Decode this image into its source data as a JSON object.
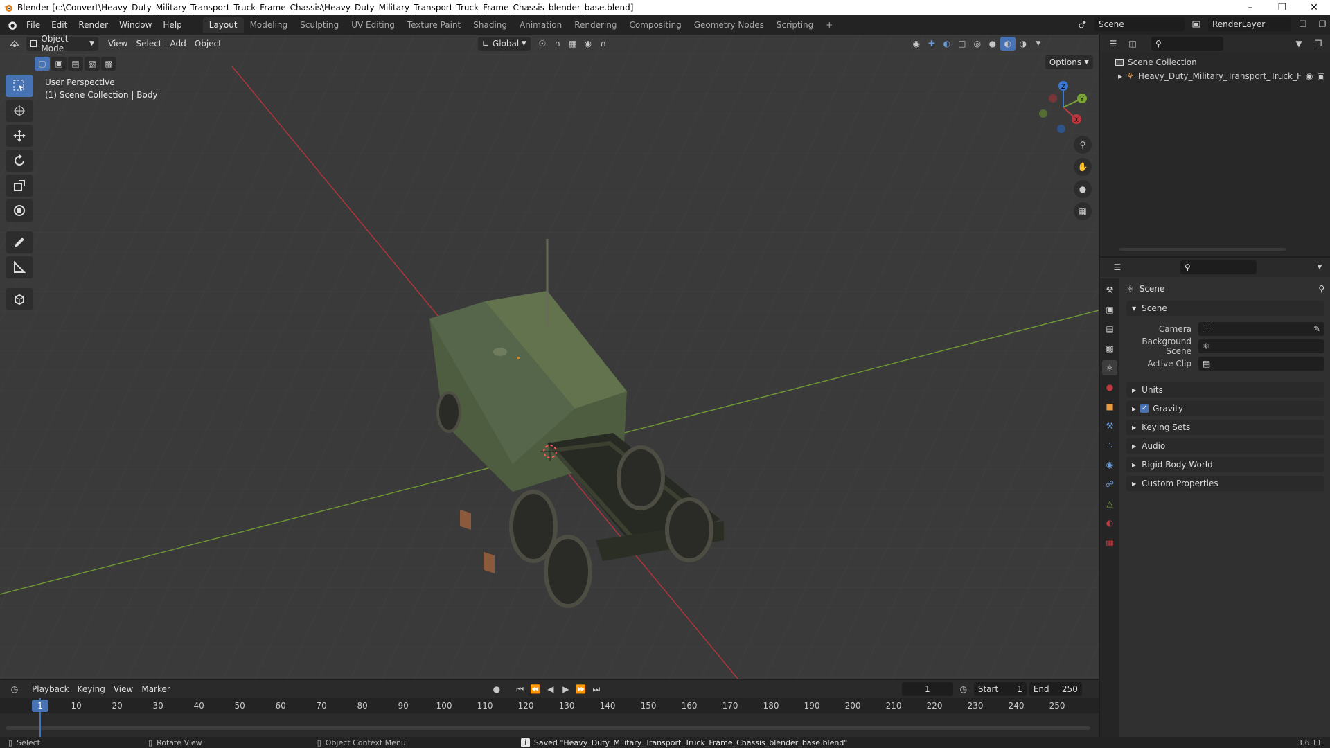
{
  "window": {
    "title": "Blender [c:\\Convert\\Heavy_Duty_Military_Transport_Truck_Frame_Chassis\\Heavy_Duty_Military_Transport_Truck_Frame_Chassis_blender_base.blend]"
  },
  "menu": [
    "File",
    "Edit",
    "Render",
    "Window",
    "Help"
  ],
  "workspaces": [
    "Layout",
    "Modeling",
    "Sculpting",
    "UV Editing",
    "Texture Paint",
    "Shading",
    "Animation",
    "Rendering",
    "Compositing",
    "Geometry Nodes",
    "Scripting"
  ],
  "active_workspace": "Layout",
  "scene_field": "Scene",
  "view_layer_field": "RenderLayer",
  "viewport": {
    "mode": "Object Mode",
    "menus": [
      "View",
      "Select",
      "Add",
      "Object"
    ],
    "orientation": "Global",
    "options_label": "Options",
    "info_line1": "User Perspective",
    "info_line2": "(1) Scene Collection | Body",
    "gizmo_axes": {
      "x": "X",
      "y": "Y",
      "z": "Z"
    }
  },
  "outliner": {
    "root": "Scene Collection",
    "items": [
      "Heavy_Duty_Military_Transport_Truck_F"
    ]
  },
  "properties": {
    "context_title": "Scene",
    "section_scene": "Scene",
    "camera_label": "Camera",
    "background_scene_label": "Background Scene",
    "active_clip_label": "Active Clip",
    "panels": [
      "Units",
      "Gravity",
      "Keying Sets",
      "Audio",
      "Rigid Body World",
      "Custom Properties"
    ]
  },
  "timeline": {
    "menus": [
      "Playback",
      "Keying",
      "View",
      "Marker"
    ],
    "current_frame": "1",
    "start_label": "Start",
    "start_value": "1",
    "end_label": "End",
    "end_value": "250",
    "ruler": [
      "10",
      "20",
      "30",
      "40",
      "50",
      "60",
      "70",
      "80",
      "90",
      "100",
      "110",
      "120",
      "130",
      "140",
      "150",
      "160",
      "170",
      "180",
      "190",
      "200",
      "210",
      "220",
      "230",
      "240",
      "250"
    ],
    "playhead_label": "1"
  },
  "status": {
    "select": "Select",
    "rotate": "Rotate View",
    "context_menu": "Object Context Menu",
    "message": "Saved \"Heavy_Duty_Military_Transport_Truck_Frame_Chassis_blender_base.blend\"",
    "version": "3.6.11"
  },
  "colors": {
    "accent": "#4772b3",
    "x_axis": "#c0383f",
    "y_axis": "#7aa338",
    "z_axis": "#3a78d6"
  }
}
